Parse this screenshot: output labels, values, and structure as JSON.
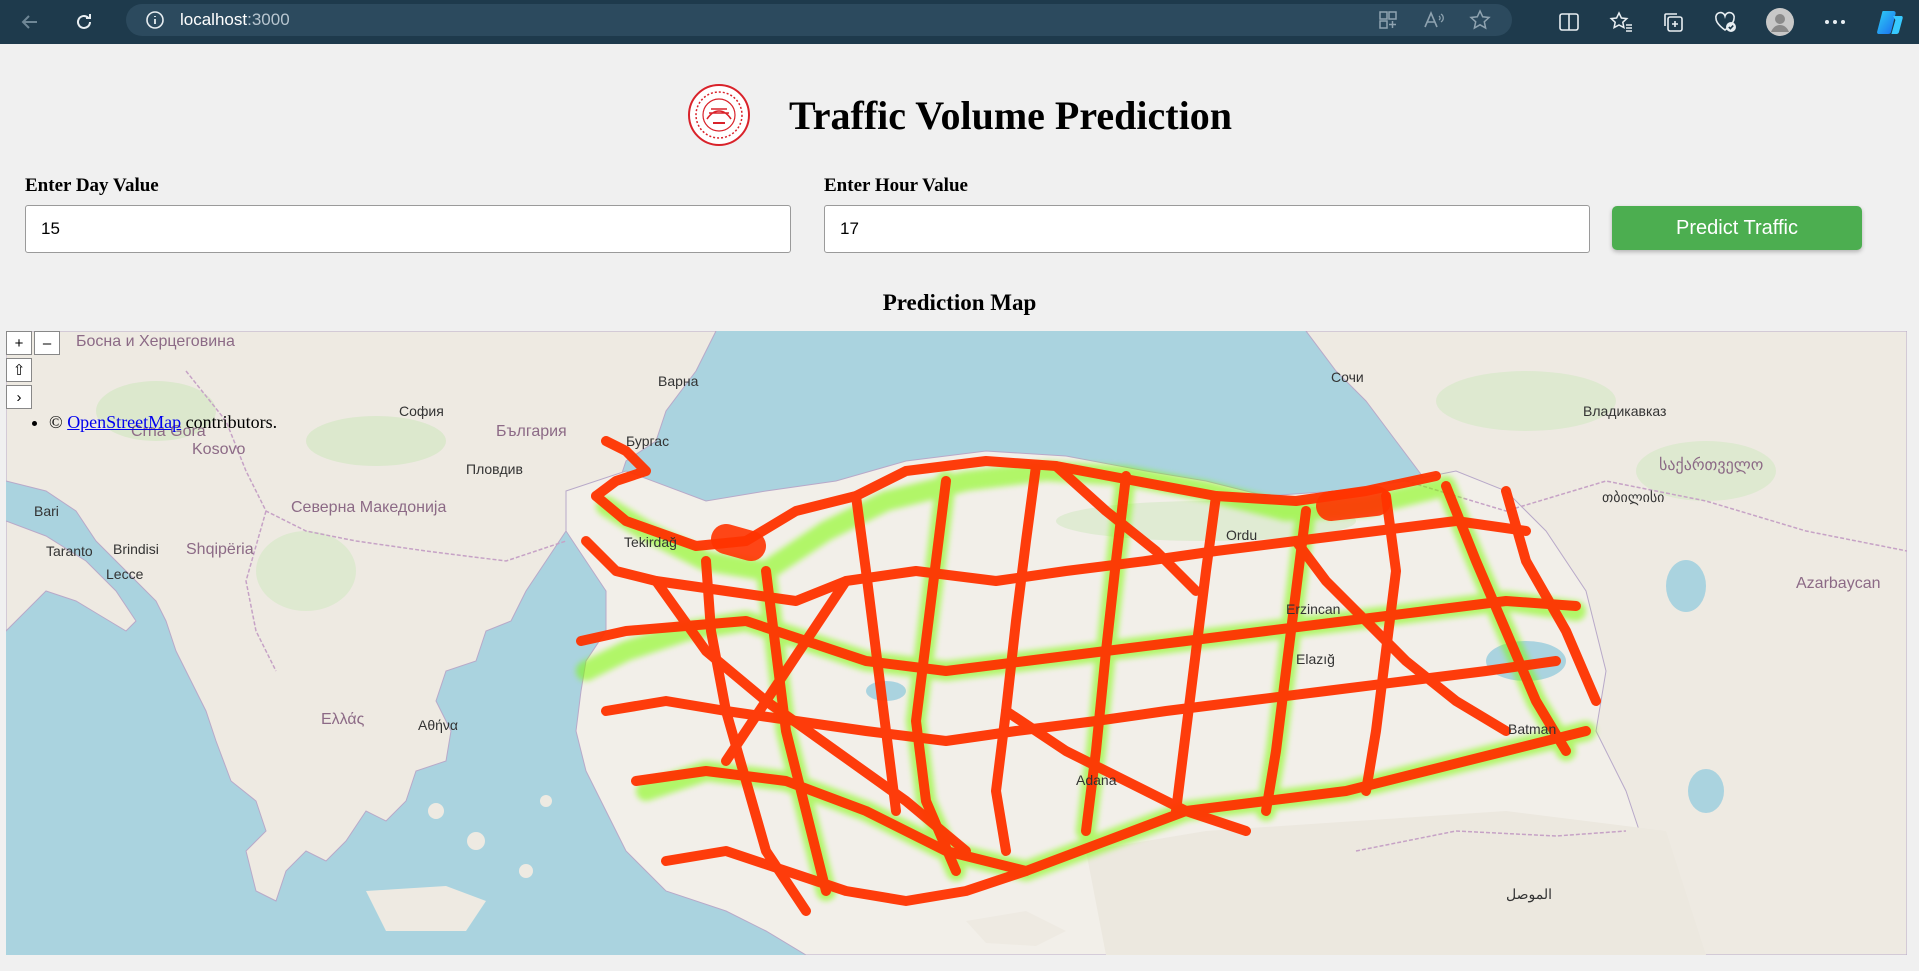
{
  "browser": {
    "url_host": "localhost",
    "url_port": ":3000",
    "icons": [
      "back-arrow-icon",
      "reload-icon",
      "site-info-icon",
      "apps-icon",
      "read-aloud-icon",
      "favorite-star-icon",
      "split-screen-icon",
      "favorites-icon",
      "collections-icon",
      "browser-essentials-icon",
      "profile-avatar-icon",
      "more-options-icon",
      "copilot-icon"
    ]
  },
  "header": {
    "title": "Traffic Volume Prediction"
  },
  "form": {
    "day_label": "Enter Day Value",
    "day_value": "15",
    "hour_label": "Enter Hour Value",
    "hour_value": "17",
    "predict_label": "Predict Traffic"
  },
  "map": {
    "title": "Prediction Map",
    "controls": {
      "zoom_in": "+",
      "zoom_out": "–",
      "home": "⇧",
      "more": "›"
    },
    "attribution_prefix": "© ",
    "attribution_link": "OpenStreetMap",
    "attribution_suffix": " contributors.",
    "labels": {
      "bosna": "Босна и Херцеговина",
      "montenegro": "Crna Gora",
      "kosovo": "Kosovo",
      "albania": "Shqipëria",
      "north_macedonia": "Северна Македонија",
      "bulgaria": "България",
      "greece": "Ελλάς",
      "georgia": "საქართველო",
      "azerbaijan": "Azarbaycan",
      "sofia": "София",
      "plovdiv": "Пловдив",
      "varna": "Варна",
      "burgas": "Бургас",
      "sochi": "Сочи",
      "vladikavkaz": "Владикавказ",
      "tbilisi": "თბილისი",
      "athina": "Αθήνα",
      "bari": "Bari",
      "taranto": "Taranto",
      "brindisi": "Brindisi",
      "lecce": "Lecce",
      "tekirdag": "Tekirdağ",
      "ordu": "Ordu",
      "elazig": "Elazığ",
      "adana": "Adana",
      "erzincan": "Erzincan",
      "batman": "Batman",
      "mosul": "الموصل"
    },
    "heat_colors": {
      "core": "#ff3300",
      "mid": "#ff9900",
      "edge": "#7cfc00"
    }
  }
}
